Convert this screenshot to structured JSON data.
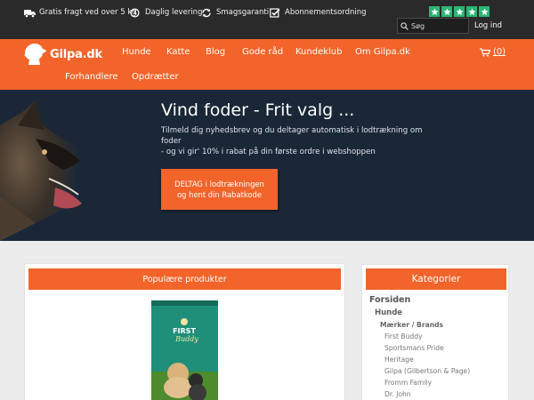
{
  "topbar": {
    "usps": [
      {
        "icon": "truck-icon",
        "label": "Gratis fragt ved over 5 kg"
      },
      {
        "icon": "clock-icon",
        "label": "Daglig levering"
      },
      {
        "icon": "refresh-icon",
        "label": "Smagsgaranti"
      },
      {
        "icon": "checkbox-icon",
        "label": "Abonnementsordning"
      }
    ],
    "rating_stars": 5,
    "rating_color": "#2bb673",
    "search_placeholder": "Søg",
    "login_label": "Log ind"
  },
  "nav": {
    "logo_text": "Gilpa.dk",
    "items": [
      "Hunde",
      "Katte",
      "Blog",
      "Gode råd",
      "Kundeklub",
      "Om Gilpa.dk",
      "Forhandlere",
      "Opdrætter"
    ],
    "cart_label": "(0)",
    "accent_color": "#f2642a"
  },
  "hero": {
    "title": "Vind foder - Frit valg ...",
    "text_line1": "Tilmeld dig nyhedsbrev og du deltager automatisk i lodtrækning om foder",
    "text_line2": "- og vi gir' 10% i rabat på din første ordre i webshoppen",
    "button_line1": "DELTAG i lodtrækningen",
    "button_line2": "og hent din Rabatkode"
  },
  "popular": {
    "heading": "Populære produkter",
    "product_brand": "FIRST",
    "product_name": "Buddy"
  },
  "categories": {
    "heading": "Kategorier",
    "items": [
      {
        "label": "Forsiden",
        "level": 0
      },
      {
        "label": "Hunde",
        "level": 1
      },
      {
        "label": "Mærker / Brands",
        "level": 2
      },
      {
        "label": "First Buddy",
        "level": 3
      },
      {
        "label": "Sportsmans Pride",
        "level": 3
      },
      {
        "label": "Heritage",
        "level": 3
      },
      {
        "label": "Gilpa (Gilbertson & Page)",
        "level": 3
      },
      {
        "label": "Fromm Family",
        "level": 3
      },
      {
        "label": "Dr. John",
        "level": 3
      }
    ]
  }
}
